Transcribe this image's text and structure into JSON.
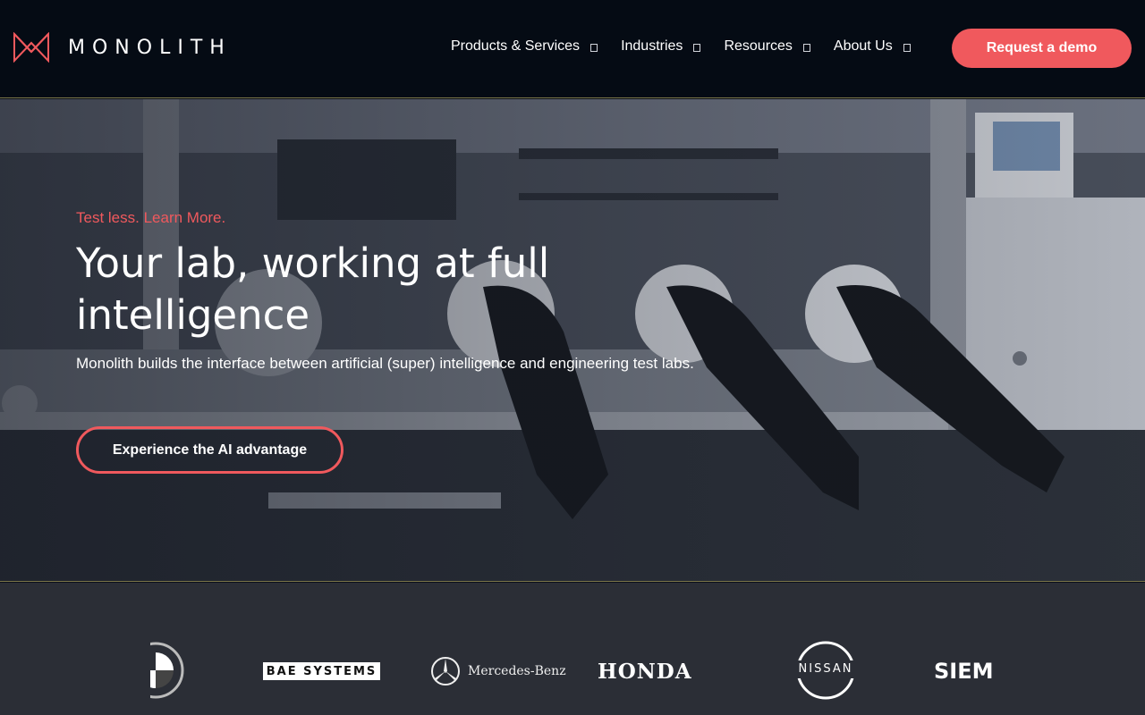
{
  "header": {
    "brand": "MONOLITH",
    "nav": [
      {
        "label": "Products & Services"
      },
      {
        "label": "Industries"
      },
      {
        "label": "Resources"
      },
      {
        "label": "About Us"
      }
    ],
    "cta_label": "Request a demo"
  },
  "hero": {
    "eyebrow": "Test less. Learn More.",
    "headline": "Your lab, working at full intelligence",
    "subhead": "Monolith builds the interface between artificial (super) intelligence and engineering test labs.",
    "button_label": "Experience the AI advantage"
  },
  "logos": {
    "bae": "BAE SYSTEMS",
    "mercedes": "Mercedes-Benz",
    "honda": "HONDA",
    "nissan": "NISSAN",
    "siemens": "SIEMENS",
    "bmw": "BMW"
  },
  "colors": {
    "accent": "#f0595d",
    "header_bg": "#050b14",
    "logos_bg": "#2b2e36"
  }
}
